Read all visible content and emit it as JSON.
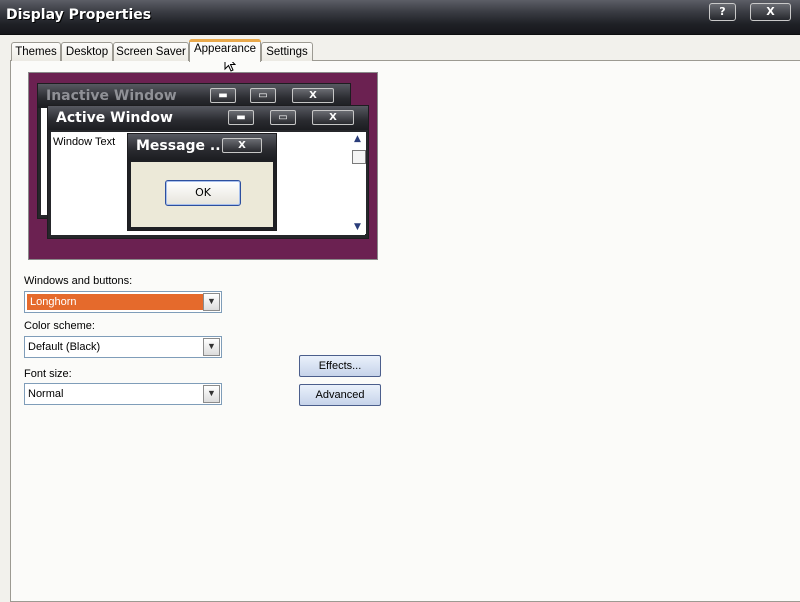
{
  "window": {
    "title": "Display Properties",
    "help_glyph": "?",
    "close_glyph": "X"
  },
  "tabs": [
    {
      "label": "Themes",
      "active": false
    },
    {
      "label": "Desktop",
      "active": false
    },
    {
      "label": "Screen Saver",
      "active": false
    },
    {
      "label": "Appearance",
      "active": true
    },
    {
      "label": "Settings",
      "active": false
    }
  ],
  "preview": {
    "background_color": "#6b2151",
    "inactive_title": "Inactive Window",
    "active_title": "Active Window",
    "window_text": "Window Text",
    "message_title": "Message ...",
    "ok_label": "OK",
    "min_glyph": "▬",
    "max_glyph": "▭",
    "close_glyph": "X"
  },
  "fields": {
    "windows_buttons_label": "Windows and buttons:",
    "windows_buttons_value": "Longhorn",
    "color_scheme_label": "Color scheme:",
    "color_scheme_value": "Default (Black)",
    "font_size_label": "Font size:",
    "font_size_value": "Normal"
  },
  "buttons": {
    "effects": "Effects...",
    "advanced": "Advanced"
  },
  "colors": {
    "highlight": "#e56a2c",
    "titlebar": "#1f2126",
    "active_tab_accent": "#e9a94b"
  }
}
